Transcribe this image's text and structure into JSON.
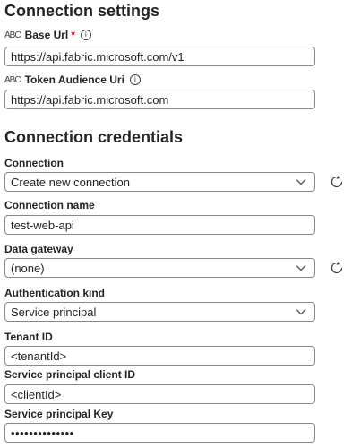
{
  "connection_settings": {
    "title": "Connection settings",
    "base_url": {
      "label": "Base Url",
      "required_mark": "*",
      "value": "https://api.fabric.microsoft.com/v1"
    },
    "token_audience": {
      "label": "Token Audience Uri",
      "value": "https://api.fabric.microsoft.com"
    },
    "type_icon_text": "ABC"
  },
  "connection_credentials": {
    "title": "Connection credentials",
    "connection": {
      "label": "Connection",
      "value": "Create new connection"
    },
    "connection_name": {
      "label": "Connection name",
      "value": "test-web-api"
    },
    "data_gateway": {
      "label": "Data gateway",
      "value": "(none)"
    },
    "auth_kind": {
      "label": "Authentication kind",
      "value": "Service principal"
    },
    "tenant_id": {
      "label": "Tenant ID",
      "value": "<tenantId>"
    },
    "client_id": {
      "label": "Service principal client ID",
      "value": "<clientId>"
    },
    "key": {
      "label": "Service principal Key",
      "value": "••••••••••••••"
    }
  },
  "icons": {
    "info": "info-icon",
    "refresh": "refresh-icon",
    "chevron": "chevron-down-icon"
  }
}
